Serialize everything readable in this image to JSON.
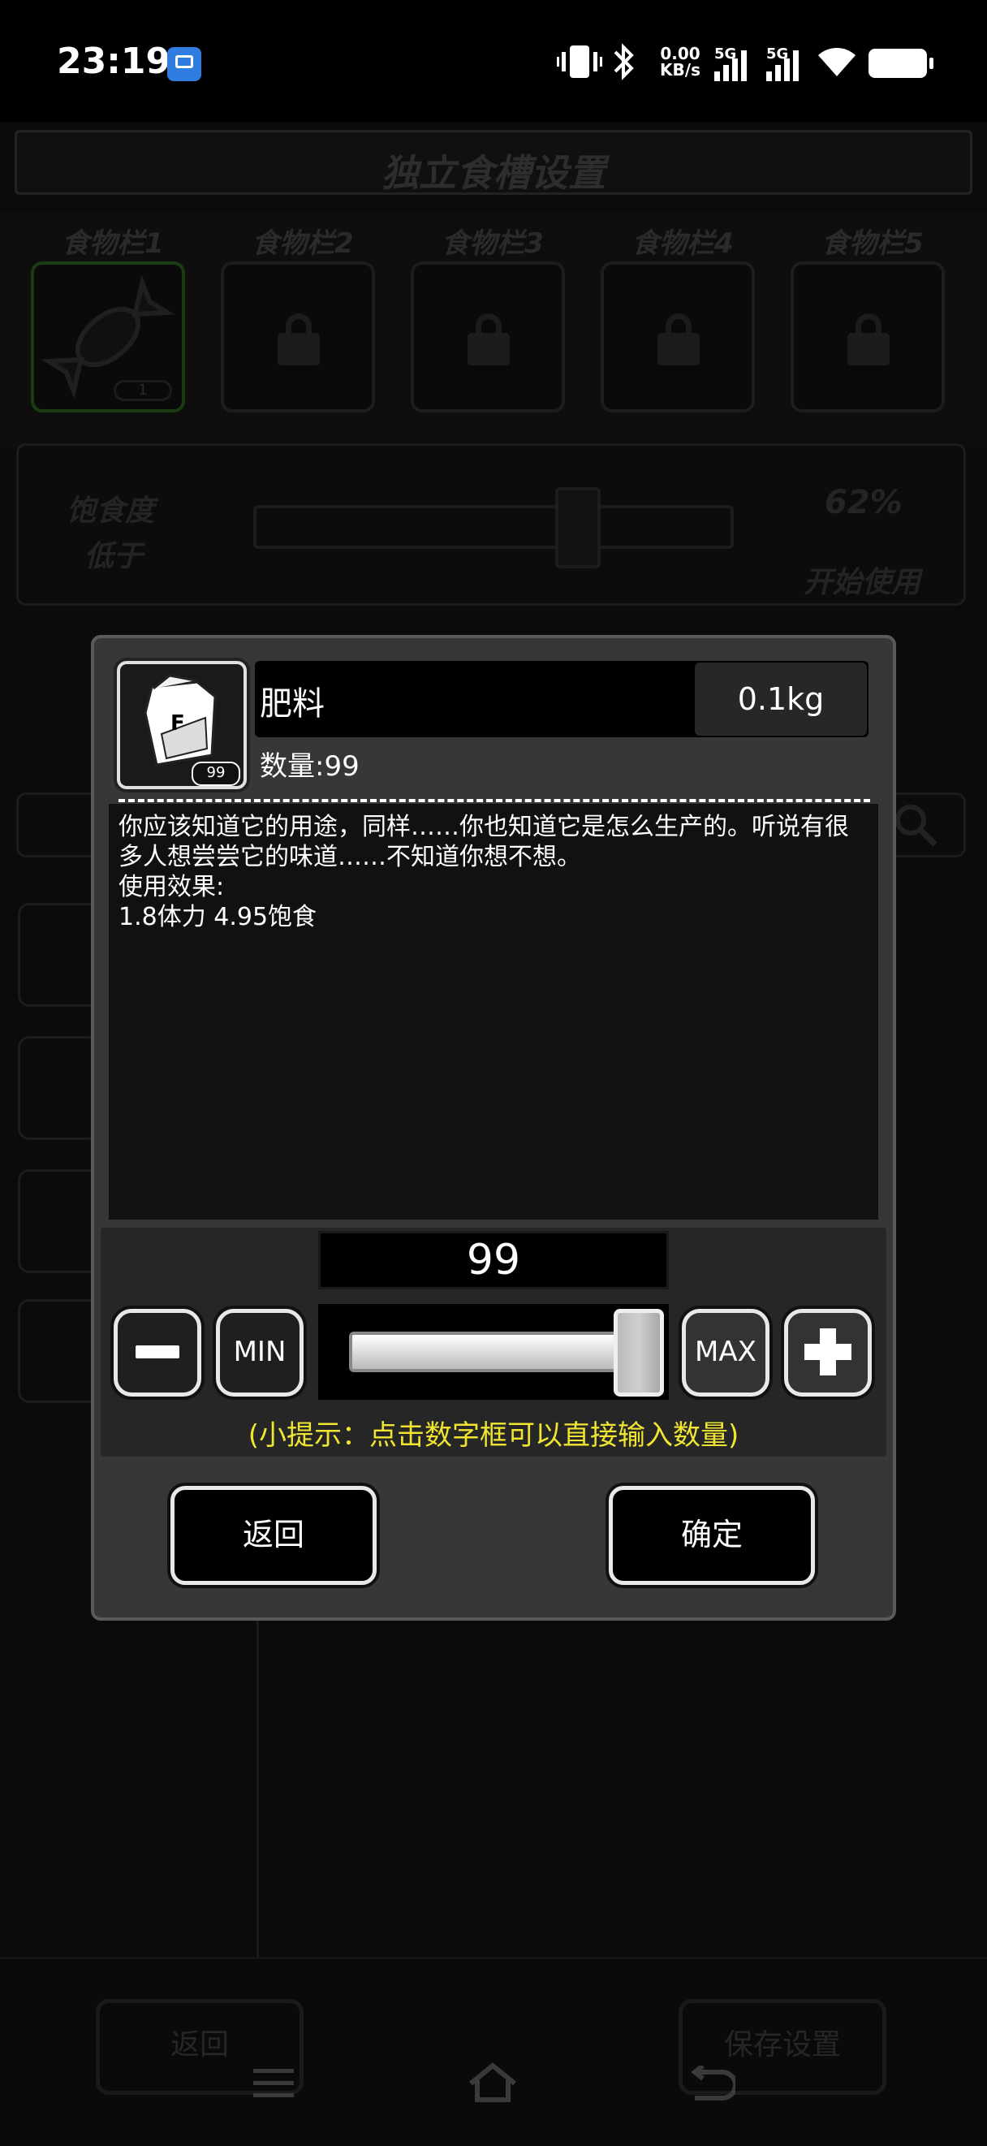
{
  "status_bar": {
    "time": "23:19",
    "net_speed_value": "0.00",
    "net_speed_unit": "KB/s",
    "signal1_label": "5G",
    "signal2_label": "5G",
    "icons": [
      "app-badge-icon",
      "vibrate-icon",
      "bluetooth-icon",
      "signal-icon",
      "signal-icon",
      "wifi-icon",
      "battery-icon"
    ]
  },
  "background": {
    "title": "独立食槽设置",
    "slots": [
      {
        "label": "食物栏1",
        "count": "1",
        "state": "filled"
      },
      {
        "label": "食物栏2",
        "state": "locked"
      },
      {
        "label": "食物栏3",
        "state": "locked"
      },
      {
        "label": "食物栏4",
        "state": "locked"
      },
      {
        "label": "食物栏5",
        "state": "locked"
      }
    ],
    "threshold_label_line1": "饱食度",
    "threshold_label_line2": "低于",
    "threshold_percent": "62%",
    "threshold_suffix": "开始使用",
    "threshold_value": 0.62,
    "back_button": "返回",
    "save_button": "保存设置"
  },
  "dialog": {
    "item_name": "肥料",
    "item_weight": "0.1kg",
    "item_icon_letter": "F",
    "item_icon_count": "99",
    "quantity_label": "数量:99",
    "description": "你应该知道它的用途，同样……你也知道它是怎么生产的。听说有很多人想尝尝它的味道……不知道你想不想。\n使用效果:\n1.8体力 4.95饱食",
    "quantity_value": "99",
    "slider_fraction": 1.0,
    "min_label": "MIN",
    "max_label": "MAX",
    "tip": "(小提示：点击数字框可以直接输入数量)",
    "back_button": "返回",
    "confirm_button": "确定"
  },
  "nav_bar": {
    "icons": [
      "menu-icon",
      "home-icon",
      "back-icon"
    ]
  }
}
